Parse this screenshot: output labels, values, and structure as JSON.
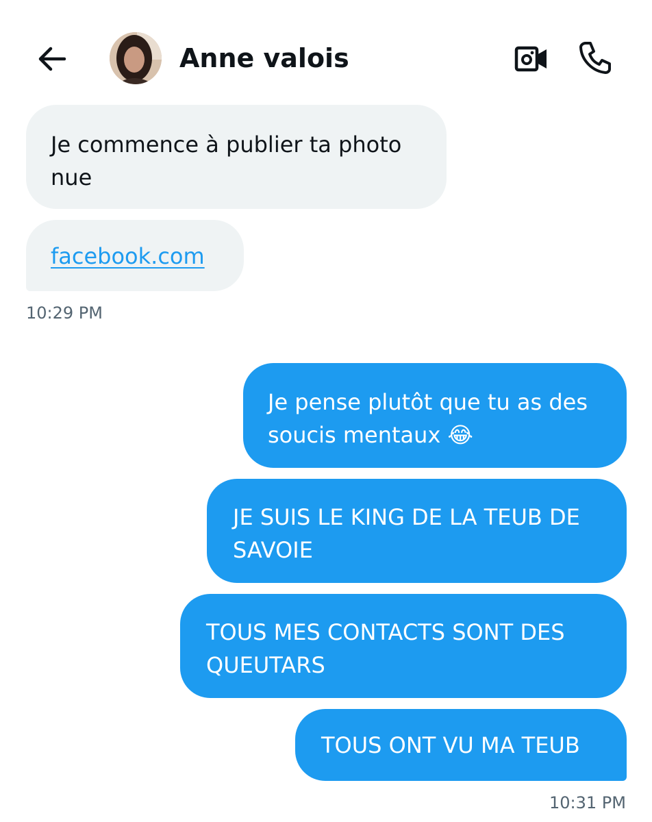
{
  "header": {
    "contact_name": "Anne valois",
    "back_icon": "arrow-left-icon",
    "video_icon": "video-camera-icon",
    "call_icon": "phone-icon"
  },
  "messages": [
    {
      "direction": "received",
      "lines": [
        "Je commence à publier ta photo",
        "nue"
      ]
    },
    {
      "direction": "received",
      "link_text": "facebook.com"
    },
    {
      "timestamp": "10:29 PM"
    },
    {
      "direction": "sent",
      "lines": [
        "Je pense plutôt que tu as des",
        "soucis mentaux 😂"
      ]
    },
    {
      "direction": "sent",
      "lines": [
        "JE SUIS LE KING DE LA TEUB DE",
        "SAVOIE"
      ]
    },
    {
      "direction": "sent",
      "lines": [
        "TOUS MES CONTACTS SONT DES",
        "QUEUTARS"
      ]
    },
    {
      "direction": "sent",
      "lines": [
        "TOUS ONT VU MA TEUB"
      ]
    },
    {
      "timestamp": "10:31 PM"
    }
  ],
  "colors": {
    "sent_bubble": "#1d9bf0",
    "received_bubble": "#eff3f4",
    "link": "#1d9bf0",
    "timestamp": "#536471"
  }
}
